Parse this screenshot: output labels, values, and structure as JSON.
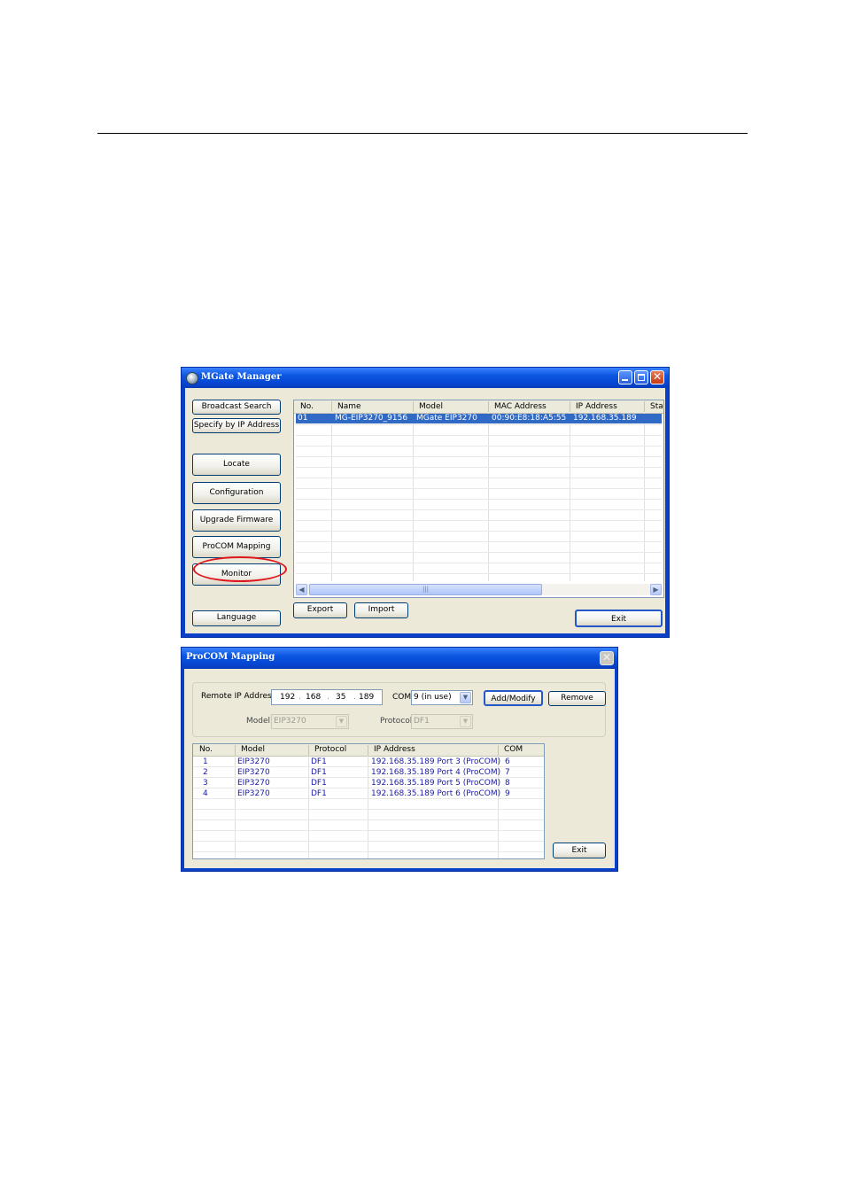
{
  "mgate_manager": {
    "title": "MGate Manager",
    "buttons": {
      "broadcast_search": "Broadcast Search",
      "specify_by_ip": "Specify by IP Address",
      "locate": "Locate",
      "configuration": "Configuration",
      "upgrade_firmware": "Upgrade Firmware",
      "procom_mapping": "ProCOM Mapping",
      "monitor": "Monitor",
      "language": "Language",
      "export": "Export",
      "import": "Import",
      "exit": "Exit"
    },
    "device_list": {
      "columns": [
        "No.",
        "Name",
        "Model",
        "MAC Address",
        "IP Address",
        "Sta"
      ],
      "rows": [
        {
          "no": "01",
          "name": "MG-EIP3270_9156",
          "model": "MGate EIP3270",
          "mac": "00:90:E8:18:A5:55",
          "ip": "192.168.35.189",
          "status": ""
        }
      ]
    },
    "highlight": "ProCOM Mapping circled in red"
  },
  "procom_mapping": {
    "title": "ProCOM Mapping",
    "remote_ip_label": "Remote IP Address",
    "ip_octets": [
      "192",
      "168",
      "35",
      "189"
    ],
    "com_label": "COM",
    "com_value": "9 (in use)",
    "model_label": "Model",
    "model_value": "EIP3270",
    "protocol_label": "Protocol",
    "protocol_value": "DF1",
    "buttons": {
      "add_modify": "Add/Modify",
      "remove": "Remove",
      "exit": "Exit"
    },
    "table": {
      "columns": [
        "No.",
        "Model",
        "Protocol",
        "IP Address",
        "COM"
      ],
      "rows": [
        {
          "no": "1",
          "model": "EIP3270",
          "protocol": "DF1",
          "ip": "192.168.35.189 Port 3 (ProCOM)",
          "com": "6"
        },
        {
          "no": "2",
          "model": "EIP3270",
          "protocol": "DF1",
          "ip": "192.168.35.189 Port 4 (ProCOM)",
          "com": "7"
        },
        {
          "no": "3",
          "model": "EIP3270",
          "protocol": "DF1",
          "ip": "192.168.35.189 Port 5 (ProCOM)",
          "com": "8"
        },
        {
          "no": "4",
          "model": "EIP3270",
          "protocol": "DF1",
          "ip": "192.168.35.189 Port 6 (ProCOM)",
          "com": "9"
        }
      ]
    }
  },
  "colors": {
    "selection": "#316ac5",
    "title_blue": "#0a3fc8",
    "highlight_red": "#e0151c"
  }
}
